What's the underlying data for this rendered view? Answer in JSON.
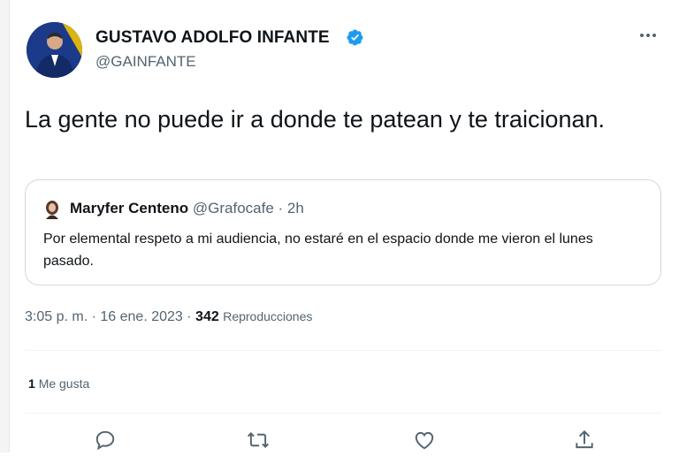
{
  "tweet": {
    "author": {
      "name": "GUSTAVO ADOLFO INFANTE",
      "handle": "@GAINFANTE",
      "verified_color": "#1d9bf0"
    },
    "text": "La gente no puede ir a donde te patean y te traicionan.",
    "quoted": {
      "name": "Maryfer Centeno",
      "handle": "@Grafocafe",
      "separator": "·",
      "time": "2h",
      "text": "Por elemental respeto a mi audiencia, no estaré en el espacio donde me vieron el lunes pasado."
    },
    "meta": {
      "time": "3:05 p. m.",
      "separator": "·",
      "date": "16 ene. 2023",
      "views_count": "342",
      "views_label": "Reproducciones"
    },
    "stats": {
      "likes_count": "1",
      "likes_label": "Me gusta"
    },
    "actions": [
      "reply-icon",
      "retweet-icon",
      "like-icon",
      "share-icon"
    ]
  }
}
